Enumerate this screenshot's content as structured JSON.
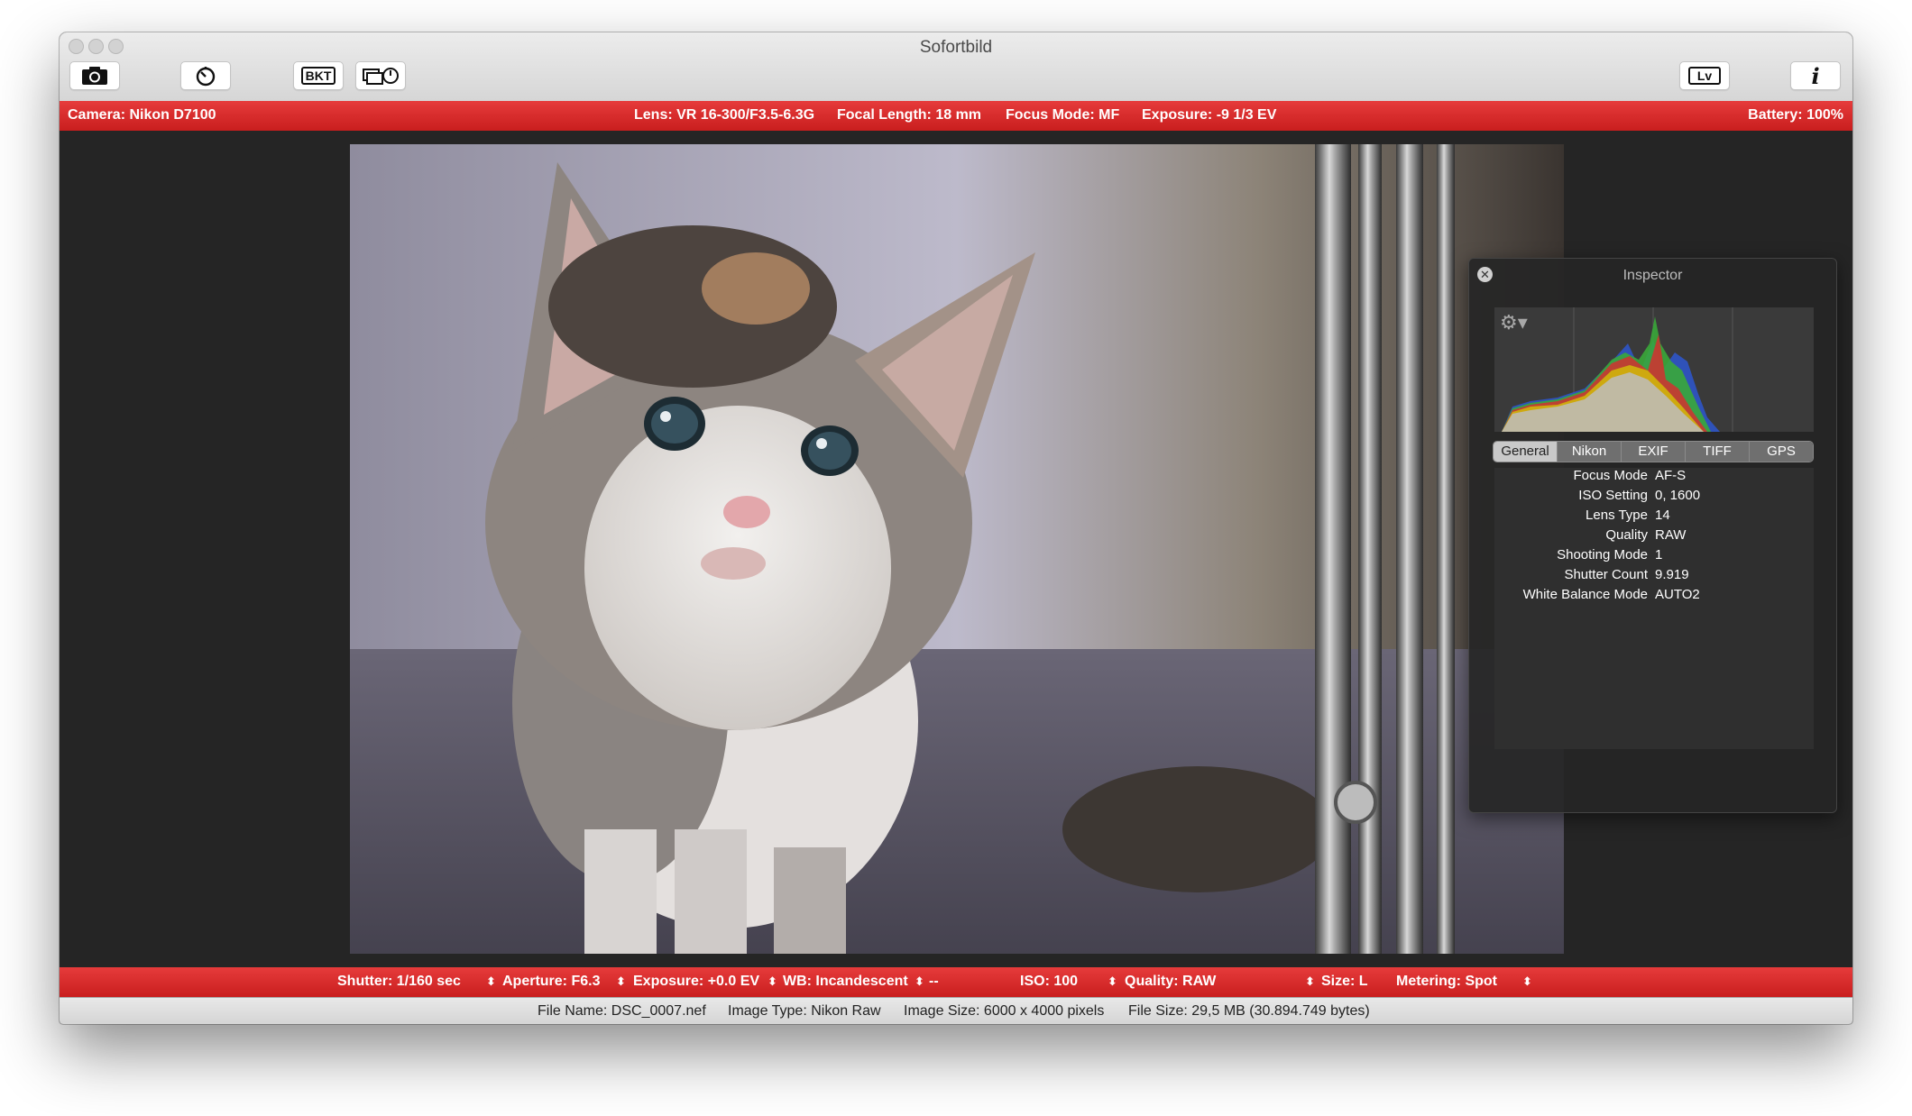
{
  "window": {
    "title": "Sofortbild"
  },
  "toolbar": {
    "bracketing_label": "BKT",
    "liveview_label": "Lv",
    "info_label": "i"
  },
  "status_top": {
    "camera": "Camera: Nikon D7100",
    "lens": "Lens: VR 16-300/F3.5-6.3G",
    "focal_length": "Focal Length: 18 mm",
    "focus_mode": "Focus Mode: MF",
    "exposure": "Exposure: -9 1/3 EV",
    "battery": "Battery: 100%"
  },
  "inspector": {
    "title": "Inspector",
    "tabs": [
      "General",
      "Nikon",
      "EXIF",
      "TIFF",
      "GPS"
    ],
    "active_tab": "General",
    "properties": [
      {
        "key": "Focus Mode",
        "value": "AF-S"
      },
      {
        "key": "ISO Setting",
        "value": "0, 1600"
      },
      {
        "key": "Lens Type",
        "value": "14"
      },
      {
        "key": "Quality",
        "value": "RAW"
      },
      {
        "key": "Shooting Mode",
        "value": "1"
      },
      {
        "key": "Shutter Count",
        "value": "9.919"
      },
      {
        "key": "White Balance Mode",
        "value": "AUTO2"
      }
    ]
  },
  "controls": {
    "shutter": "Shutter: 1/160 sec",
    "aperture": "Aperture:  F6.3",
    "exposure": "Exposure: +0.0 EV",
    "wb": "WB: Incandescent",
    "wb_extra": "--",
    "iso": "ISO: 100",
    "quality": "Quality:  RAW",
    "size": "Size: L",
    "metering": "Metering: Spot",
    "stepper_glyph": "⬍"
  },
  "file_info": {
    "file_name": "File Name: DSC_0007.nef",
    "image_type": "Image Type: Nikon Raw",
    "image_size": "Image Size: 6000 x 4000 pixels",
    "file_size": "File Size: 29,5 MB (30.894.749 bytes)"
  },
  "colors": {
    "accent_red": "#d62b2b"
  },
  "icons": [
    "camera-icon",
    "self-timer-icon",
    "bracketing-icon",
    "timelapse-icon",
    "liveview-icon",
    "info-icon",
    "gear-icon",
    "close-icon"
  ]
}
